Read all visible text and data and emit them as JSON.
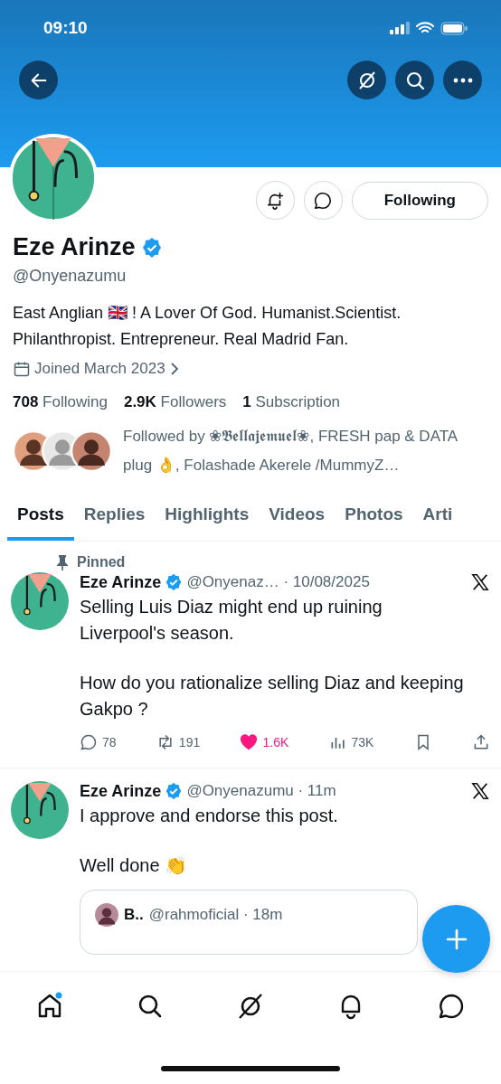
{
  "status_bar": {
    "time": "09:10"
  },
  "profile": {
    "name": "Eze Arinze",
    "verified": true,
    "handle": "@Onyenazumu",
    "follow_button": "Following",
    "bio": "East Anglian 🇬🇧 ! A Lover Of God. Humanist.Scientist. Philanthropist. Entrepreneur. Real Madrid Fan.",
    "joined": "Joined March 2023",
    "stats": [
      "**708** Following",
      "**2.9K** Followers",
      "**1** Subscription"
    ],
    "followed_by": "Followed by ❀𝕭𝖊𝖑𝖑𝖆𝖏𝖊𝖒𝖚𝖊𝖑❀, FRESH pap & DATA plug 👌, Folashade Akerele /MummyZ…"
  },
  "tabs": [
    {
      "label": "Posts",
      "selected": true
    },
    {
      "label": "Replies",
      "selected": false
    },
    {
      "label": "Highlights",
      "selected": false
    },
    {
      "label": "Videos",
      "selected": false
    },
    {
      "label": "Photos",
      "selected": false
    },
    {
      "label": "Arti",
      "selected": false
    }
  ],
  "posts": [
    {
      "pinned": "Pinned",
      "name": "Eze Arinze",
      "verified": true,
      "meta": "@Onyenaz… · 10/08/2025",
      "paragraphs": [
        "Selling Luis Diaz might end up ruining Liverpool's season.",
        "How do you rationalize selling Diaz and keeping Gakpo ?"
      ],
      "actions": [
        {
          "kind": "reply",
          "count": "78",
          "active": false
        },
        {
          "kind": "repost",
          "count": "191",
          "active": false
        },
        {
          "kind": "like",
          "count": "1.6K",
          "active": true
        },
        {
          "kind": "views",
          "count": "73K",
          "active": false
        },
        {
          "kind": "bookmark",
          "active": false
        },
        {
          "kind": "share",
          "active": false
        }
      ]
    },
    {
      "name": "Eze Arinze",
      "verified": true,
      "meta": "@Onyenazumu · 11m",
      "paragraphs": [
        "I approve and endorse this post.",
        "Well done 👏"
      ],
      "quote": {
        "name": "B..",
        "meta": "@rahmoficial · 18m"
      }
    }
  ],
  "bottom_nav": [
    {
      "kind": "home",
      "dot": true
    },
    {
      "kind": "search",
      "dot": false
    },
    {
      "kind": "grok",
      "dot": false
    },
    {
      "kind": "bell",
      "dot": false
    },
    {
      "kind": "chat",
      "dot": false
    }
  ]
}
